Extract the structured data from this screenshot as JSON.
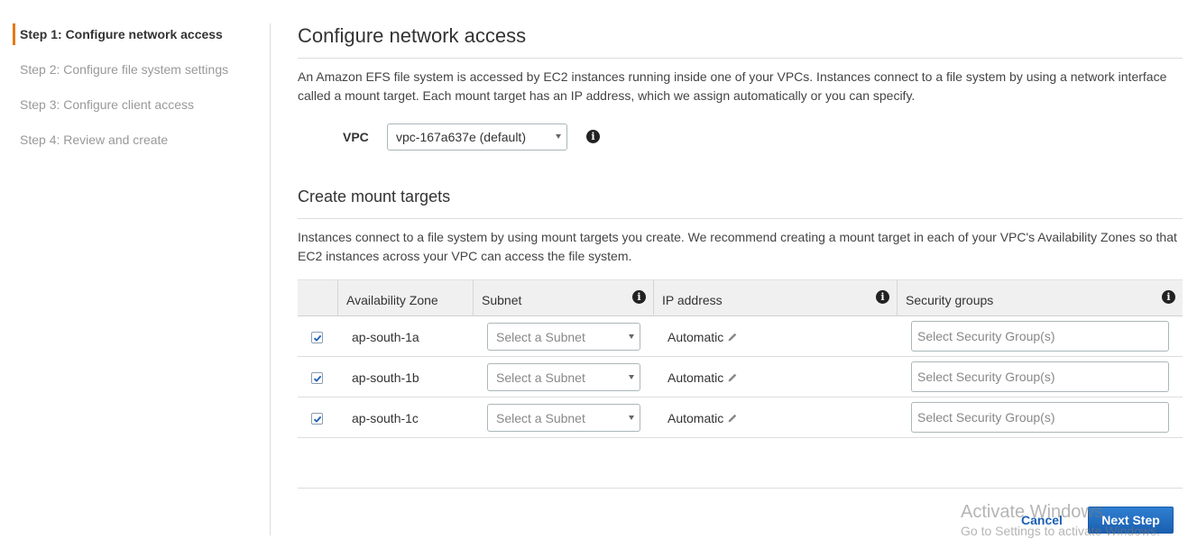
{
  "sidebar": {
    "steps": [
      {
        "label": "Step 1: Configure network access",
        "active": true
      },
      {
        "label": "Step 2: Configure file system settings",
        "active": false
      },
      {
        "label": "Step 3: Configure client access",
        "active": false
      },
      {
        "label": "Step 4: Review and create",
        "active": false
      }
    ]
  },
  "main": {
    "title": "Configure network access",
    "intro_line1": "An Amazon EFS file system is accessed by EC2 instances running inside one of your VPCs. Instances connect to a file system by using a network interface",
    "intro_line2": "called a mount target. Each mount target has an IP address, which we assign automatically or you can specify.",
    "vpc": {
      "label": "VPC",
      "value": "vpc-167a637e (default)"
    },
    "mount_targets": {
      "title": "Create mount targets",
      "desc_line1": "Instances connect to a file system by using mount targets you create. We recommend creating a mount target in each of your VPC's Availability Zones so that",
      "desc_line2": "EC2 instances across your VPC can access the file system.",
      "columns": {
        "availability_zone": "Availability Zone",
        "subnet": "Subnet",
        "ip_address": "IP address",
        "security_groups": "Security groups"
      },
      "rows": [
        {
          "checked": true,
          "zone": "ap-south-1a",
          "subnet_placeholder": "Select a Subnet",
          "ip": "Automatic",
          "sg_placeholder": "Select Security Group(s)"
        },
        {
          "checked": true,
          "zone": "ap-south-1b",
          "subnet_placeholder": "Select a Subnet",
          "ip": "Automatic",
          "sg_placeholder": "Select Security Group(s)"
        },
        {
          "checked": true,
          "zone": "ap-south-1c",
          "subnet_placeholder": "Select a Subnet",
          "ip": "Automatic",
          "sg_placeholder": "Select Security Group(s)"
        }
      ]
    }
  },
  "footer": {
    "cancel_label": "Cancel",
    "next_label": "Next Step"
  },
  "watermark": {
    "line1": "Activate Windows",
    "line2": "Go to Settings to activate Windows."
  },
  "colors": {
    "accent": "#e47911",
    "primary_button": "#1b5fb0",
    "link": "#1a5fb4"
  },
  "icons": {
    "info": "info-icon",
    "pencil": "pencil-icon",
    "check": "check-icon",
    "caret": "caret-down-icon"
  }
}
